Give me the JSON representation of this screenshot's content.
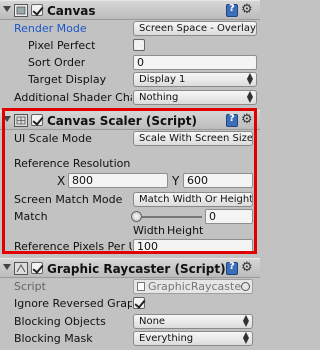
{
  "canvas": {
    "title": "Canvas",
    "enabled": true,
    "render_mode_label": "Render Mode",
    "render_mode_value": "Screen Space - Overlay",
    "pixel_perfect_label": "Pixel Perfect",
    "pixel_perfect": false,
    "sort_order_label": "Sort Order",
    "sort_order_value": "0",
    "target_display_label": "Target Display",
    "target_display_value": "Display 1",
    "additional_shader_label": "Additional Shader Cha",
    "additional_shader_value": "Nothing"
  },
  "canvas_scaler": {
    "title": "Canvas Scaler (Script)",
    "enabled": true,
    "ui_scale_mode_label": "UI Scale Mode",
    "ui_scale_mode_value": "Scale With Screen Size",
    "reference_resolution_label": "Reference Resolution",
    "x_label": "X",
    "x_value": "800",
    "y_label": "Y",
    "y_value": "600",
    "screen_match_mode_label": "Screen Match Mode",
    "screen_match_mode_value": "Match Width Or Height",
    "match_label": "Match",
    "match_value": "0",
    "width_label": "Width",
    "height_label": "Height",
    "reference_pixels_label": "Reference Pixels Per U",
    "reference_pixels_value": "100"
  },
  "graphic_raycaster": {
    "title": "Graphic Raycaster (Script)",
    "enabled": true,
    "script_label": "Script",
    "script_value": "GraphicRaycaste",
    "ignore_reversed_label": "Ignore Reversed Grap",
    "ignore_reversed": true,
    "blocking_objects_label": "Blocking Objects",
    "blocking_objects_value": "None",
    "blocking_mask_label": "Blocking Mask",
    "blocking_mask_value": "Everything"
  },
  "colors": {
    "highlight": "#e00000",
    "label_blue": "#1d57c8"
  }
}
